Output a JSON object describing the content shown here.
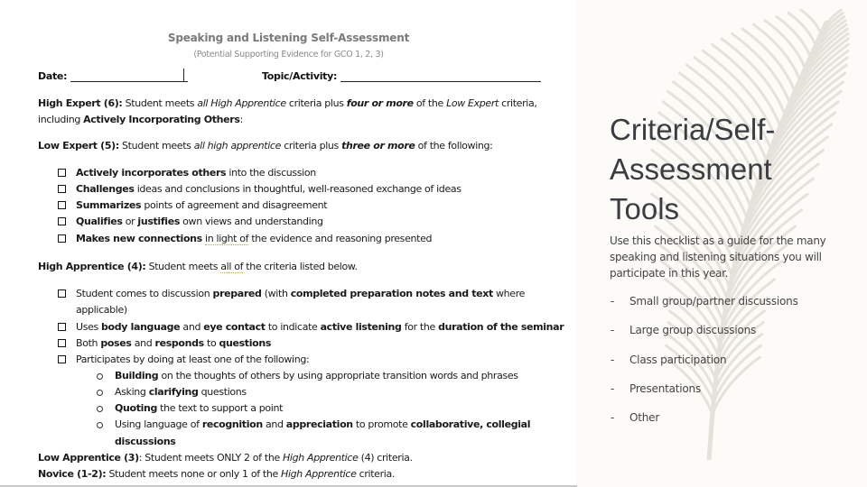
{
  "document": {
    "title": "Speaking and Listening Self-Assessment",
    "subtitle": "(Potential Supporting Evidence for GCO 1, 2, 3)",
    "date_label": "Date:",
    "date_value": "",
    "topic_label": "Topic/Activity:",
    "topic_value": "",
    "high_expert": {
      "label": "High Expert (6):",
      "t1": " Student meets ",
      "i1": "all High Apprentice",
      "t2": " criteria plus ",
      "bi1": "four or more",
      "t3": " of the ",
      "i2": "Low Expert",
      "t4": " criteria,",
      "line2_t1": "including ",
      "line2_b1": "Actively Incorporating Others",
      "line2_t2": ":"
    },
    "low_expert": {
      "label": "Low Expert (5):",
      "t1": " Student meets ",
      "i1": "all high apprentice",
      "t2": " criteria plus ",
      "bi1": "three or more",
      "t3": " of the following:",
      "items": [
        {
          "bold": "Actively incorporates others",
          "rest": " into the discussion"
        },
        {
          "bold": "Challenges",
          "rest": " ideas and conclusions in thoughtful, well-reasoned exchange of ideas"
        },
        {
          "bold": "Summarizes",
          "rest": " points of agreement and disagreement"
        },
        {
          "bold": "Qualifies",
          "mid": " or ",
          "bold2": "justifies",
          "rest": " own views and understanding"
        },
        {
          "bold": "Makes new connections",
          "sp": " ",
          "squig": "in light of",
          "rest": " the evidence and reasoning presented"
        }
      ]
    },
    "high_apprentice": {
      "label": "High Apprentice (4):",
      "t1": " Student meets ",
      "squig": "all of",
      "t2": " the criteria listed below.",
      "items": [
        {
          "t1": "Student comes to discussion ",
          "b1": "prepared",
          "t2": " (with ",
          "b2": "completed preparation notes and text",
          "t3": " where",
          "line2": "applicable)"
        },
        {
          "t1": "Uses ",
          "b1": "body language",
          "t2": " and ",
          "b2": "eye contact",
          "t3": " to indicate ",
          "b3": "active listening",
          "t4": " for the ",
          "b4": "duration of the seminar"
        },
        {
          "t1": "Both ",
          "b1": "poses",
          "t2": " and ",
          "b2": "responds",
          "t3": " to ",
          "b3": "questions"
        },
        {
          "t1": "Participates by doing at least one of the following:"
        }
      ],
      "sub_items": [
        {
          "b1": "Building",
          "t1": " on the thoughts of others by using appropriate transition words and phrases"
        },
        {
          "t1": "Asking ",
          "b1": "clarifying",
          "t2": " questions"
        },
        {
          "b1": "Quoting",
          "t1": " the text to support a point"
        },
        {
          "t1": "Using language of ",
          "b1": "recognition",
          "t2": " and ",
          "b2": "appreciation",
          "t3": " to promote ",
          "b3": "collaborative, collegial",
          "line2": "discussions"
        }
      ]
    },
    "low_apprentice": {
      "label": "Low Apprentice (3)",
      "t1": ": Student meets ONLY 2 of the ",
      "i1": "High Apprentice",
      "t2": " (4) criteria."
    },
    "novice": {
      "label": "Novice (1-2):",
      "t1": " Student meets none or only 1 of the ",
      "i1": "High Apprentice",
      "t2": " criteria."
    }
  },
  "slide": {
    "title_lines": [
      "Criteria/Self-",
      "Assessment",
      "Tools"
    ],
    "description": "Use this checklist as a guide for the many speaking and listening situations you will participate in this year.",
    "list_marker": "-",
    "list": [
      "Small group/partner discussions",
      "Large group discussions",
      "Class participation",
      "Presentations",
      "Other"
    ]
  },
  "colors": {
    "background": "#fcfbf7",
    "feather": "#e4e2da",
    "title_text": "#3a3d42"
  }
}
